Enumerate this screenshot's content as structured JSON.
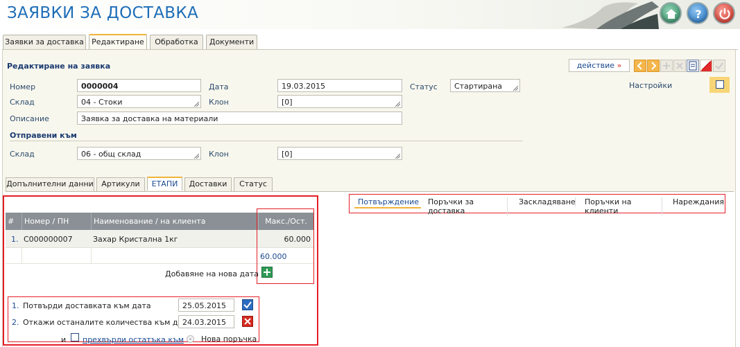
{
  "header": {
    "title": "ЗАЯВКИ ЗА ДОСТАВКА"
  },
  "top_tabs": [
    "Заявки за доставка",
    "Редактиране",
    "Обработка",
    "Документи"
  ],
  "edit": {
    "heading": "Редактиране на заявка",
    "action_label": "действие",
    "action_arrow": "»",
    "number_label": "Номер",
    "number_value": "0000004",
    "date_label": "Дата",
    "date_value": "19.03.2015",
    "status_label": "Статус",
    "status_value": "Стартирана",
    "warehouse_label": "Склад",
    "warehouse_value": "04 - Стоки",
    "branch_label": "Клон",
    "branch_value": "[0]",
    "description_label": "Описание",
    "description_value": "Заявка за доставка на материали",
    "settings_label": "Настройки",
    "sent_to_heading": "Отправени към",
    "sent_warehouse_label": "Склад",
    "sent_warehouse_value": "06 - общ склад",
    "sent_branch_label": "Клон",
    "sent_branch_value": "[0]"
  },
  "sub_tabs": [
    "Допълнителни данни",
    "Артикули",
    "ЕТАПИ",
    "Доставки",
    "Статус"
  ],
  "stage_tabs": [
    "Потвърждение",
    "Поръчки за доставка",
    "Заскладяване",
    "Поръчки на клиенти",
    "Нареждания"
  ],
  "grid": {
    "headers": [
      "#",
      "Номер / ПН",
      "Наименование / на клиента",
      "Макс./Ост."
    ],
    "rows": [
      {
        "idx": "1.",
        "number": "C000000007",
        "name": "Захар Кристална 1кг",
        "max": "60.000"
      }
    ],
    "total": "60.000",
    "add_date": "Добавяне на нова дата",
    "add_date_arrow": "»"
  },
  "actions": [
    {
      "idx": "1.",
      "label": "Потвърди доставката към дата",
      "date": "25.05.2015"
    },
    {
      "idx": "2.",
      "label": "Откажи останалите количества към дата",
      "date": "24.03.2015"
    }
  ],
  "transfer": {
    "and": "и",
    "link": "прехвърли остатъка към",
    "new_order": "Нова поръчка"
  },
  "colors": {
    "accent": "#1d6db8",
    "highlight": "#e41e26",
    "tab_active": "#f0b43a"
  }
}
